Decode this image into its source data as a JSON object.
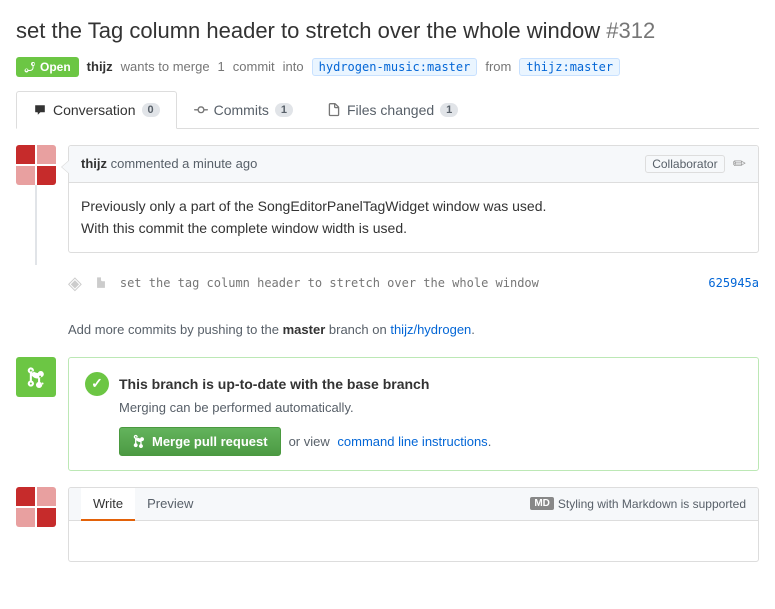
{
  "page": {
    "title": "set the Tag column header to stretch over the whole window",
    "pr_number": "#312"
  },
  "status": {
    "label": "Open",
    "icon": "git-pull-request-icon"
  },
  "meta": {
    "user": "thijz",
    "action": "wants to merge",
    "count": "1",
    "commit_word": "commit",
    "into": "into",
    "target_repo": "hydrogen-music:master",
    "from": "from",
    "source_repo": "thijz:master"
  },
  "tabs": [
    {
      "label": "Conversation",
      "count": "0",
      "active": true
    },
    {
      "label": "Commits",
      "count": "1",
      "active": false
    },
    {
      "label": "Files changed",
      "count": "1",
      "active": false
    }
  ],
  "comment": {
    "username": "thijz",
    "action": "commented",
    "time": "a minute ago",
    "collaborator_badge": "Collaborator",
    "body_line1": "Previously only a part of the SongEditorPanelTagWidget window was used.",
    "body_line2": "With this commit the complete window width is used."
  },
  "commit_row": {
    "icon": "◈",
    "message": "set the tag column header to stretch over the whole window",
    "sha": "625945a"
  },
  "push_note": {
    "prefix": "Add more commits by pushing to the",
    "branch": "master",
    "middle": "branch on",
    "repo": "thijz/hydrogen",
    "suffix": "."
  },
  "merge_status": {
    "title": "This branch is up-to-date with the base branch",
    "subtitle": "Merging can be performed automatically.",
    "merge_btn_label": "Merge pull request",
    "or_text": "or view",
    "cmd_link": "command line instructions",
    "cmd_link_suffix": "."
  },
  "write_preview": {
    "tabs": [
      "Write",
      "Preview"
    ],
    "active_tab": "Write",
    "markdown_icon": "MD",
    "markdown_text": "Styling with Markdown is supported"
  }
}
